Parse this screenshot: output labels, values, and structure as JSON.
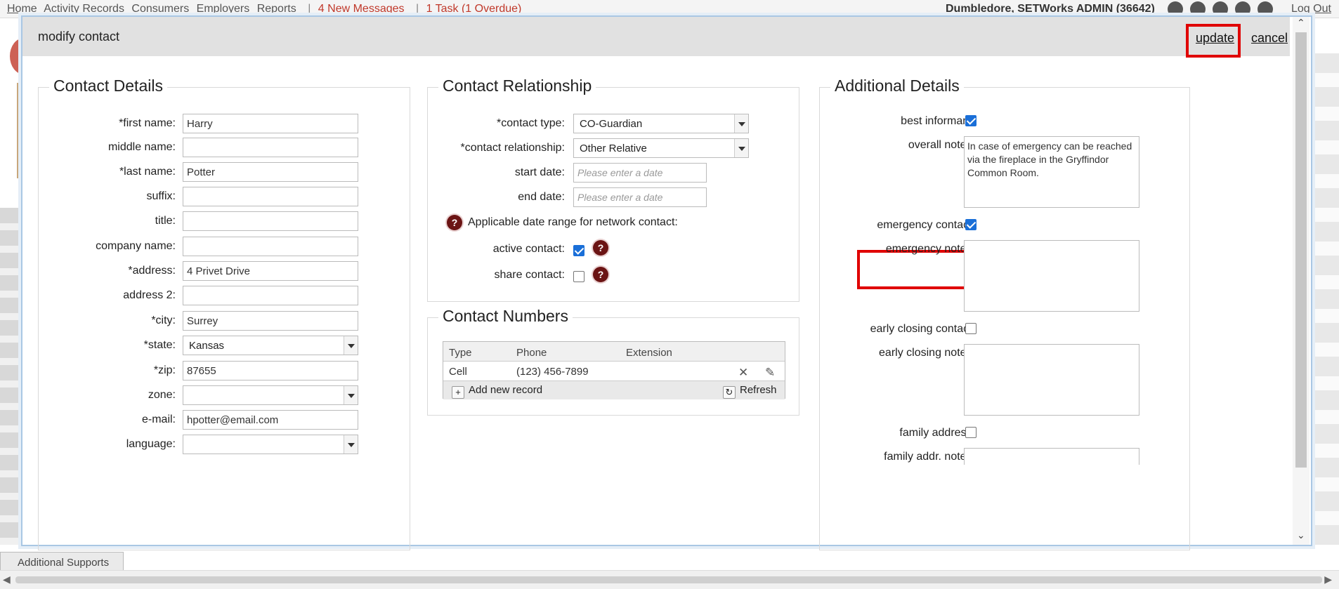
{
  "topnav": {
    "links": [
      "Home",
      "Activity Records",
      "Consumers",
      "Employers",
      "Reports"
    ],
    "messages": "4 New Messages",
    "tasks": "1 Task (1 Overdue)",
    "user": "Dumbledore, SETWorks ADMIN (36642)",
    "logout": "Log Out"
  },
  "background": {
    "bottom_tab": "Additional Supports"
  },
  "modal": {
    "title": "modify contact",
    "update_label": "update",
    "cancel_label": "cancel"
  },
  "contact_details": {
    "title": "Contact Details",
    "fields": {
      "first_name": {
        "label": "*first name:",
        "value": "Harry"
      },
      "middle_name": {
        "label": "middle name:",
        "value": ""
      },
      "last_name": {
        "label": "*last name:",
        "value": "Potter"
      },
      "suffix": {
        "label": "suffix:",
        "value": ""
      },
      "title": {
        "label": "title:",
        "value": ""
      },
      "company_name": {
        "label": "company name:",
        "value": ""
      },
      "address": {
        "label": "*address:",
        "value": "4 Privet Drive"
      },
      "address2": {
        "label": "address 2:",
        "value": ""
      },
      "city": {
        "label": "*city:",
        "value": "Surrey"
      },
      "state": {
        "label": "*state:",
        "value": "Kansas"
      },
      "zip": {
        "label": "*zip:",
        "value": "87655"
      },
      "zone": {
        "label": "zone:",
        "value": ""
      },
      "email": {
        "label": "e-mail:",
        "value": "hpotter@email.com"
      },
      "language": {
        "label": "language:",
        "value": ""
      }
    }
  },
  "contact_relationship": {
    "title": "Contact Relationship",
    "contact_type": {
      "label": "*contact type:",
      "value": "CO-Guardian"
    },
    "contact_relationship": {
      "label": "*contact relationship:",
      "value": "Other Relative"
    },
    "start_date": {
      "label": "start date:",
      "placeholder": "Please enter a date"
    },
    "end_date": {
      "label": "end date:",
      "placeholder": "Please enter a date"
    },
    "date_range_note": "Applicable date range for network contact:",
    "active_contact": {
      "label": "active contact:",
      "checked": true
    },
    "share_contact": {
      "label": "share contact:",
      "checked": false
    }
  },
  "contact_numbers": {
    "title": "Contact Numbers",
    "columns": [
      "Type",
      "Phone",
      "Extension"
    ],
    "rows": [
      {
        "type": "Cell",
        "phone": "(123) 456-7899",
        "extension": ""
      }
    ],
    "add_label": "Add new record",
    "refresh_label": "Refresh"
  },
  "additional_details": {
    "title": "Additional Details",
    "best_informant": {
      "label": "best informant:",
      "checked": true
    },
    "overall_notes": {
      "label": "overall notes:",
      "value": "In case of emergency can be reached via the fireplace in the Gryffindor Common Room."
    },
    "emergency_contact": {
      "label": "emergency contact:",
      "checked": true
    },
    "emergency_notes": {
      "label": "emergency notes:",
      "value": ""
    },
    "early_closing_contact": {
      "label": "early closing contact:",
      "checked": false
    },
    "early_closing_notes": {
      "label": "early closing notes:",
      "value": ""
    },
    "family_address": {
      "label": "family address:",
      "checked": false
    },
    "family_addr_notes": {
      "label": "family addr. notes:",
      "value": ""
    }
  },
  "colors": {
    "highlight": "#e00000",
    "checkbox": "#1a6fd8",
    "help_icon": "#6b1414"
  }
}
